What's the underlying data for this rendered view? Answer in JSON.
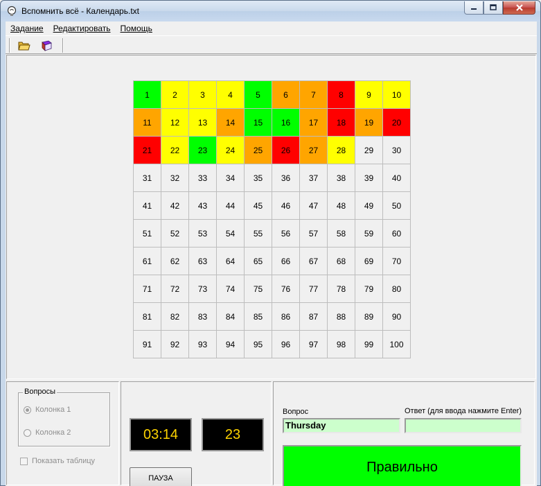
{
  "window": {
    "title": "Вспомнить всё - Календарь.txt"
  },
  "menu": [
    {
      "label": "Задание"
    },
    {
      "label": "Редактировать"
    },
    {
      "label": "Помощь"
    }
  ],
  "toolbar": {
    "buttons": [
      {
        "icon": "open-folder-icon"
      },
      {
        "icon": "book-icon"
      }
    ]
  },
  "grid": {
    "colors": {
      "green": "#00ff00",
      "yellow": "#ffff00",
      "orange": "#ffa500",
      "red": "#ff0000",
      "none": "#f0f0f0"
    },
    "cells": [
      {
        "n": "1",
        "c": "green"
      },
      {
        "n": "2",
        "c": "yellow"
      },
      {
        "n": "3",
        "c": "yellow"
      },
      {
        "n": "4",
        "c": "yellow"
      },
      {
        "n": "5",
        "c": "green"
      },
      {
        "n": "6",
        "c": "orange"
      },
      {
        "n": "7",
        "c": "orange"
      },
      {
        "n": "8",
        "c": "red"
      },
      {
        "n": "9",
        "c": "yellow"
      },
      {
        "n": "10",
        "c": "yellow"
      },
      {
        "n": "11",
        "c": "orange"
      },
      {
        "n": "12",
        "c": "yellow"
      },
      {
        "n": "13",
        "c": "yellow"
      },
      {
        "n": "14",
        "c": "orange"
      },
      {
        "n": "15",
        "c": "green"
      },
      {
        "n": "16",
        "c": "green"
      },
      {
        "n": "17",
        "c": "orange"
      },
      {
        "n": "18",
        "c": "red"
      },
      {
        "n": "19",
        "c": "orange"
      },
      {
        "n": "20",
        "c": "red"
      },
      {
        "n": "21",
        "c": "red"
      },
      {
        "n": "22",
        "c": "yellow"
      },
      {
        "n": "23",
        "c": "green"
      },
      {
        "n": "24",
        "c": "yellow"
      },
      {
        "n": "25",
        "c": "orange"
      },
      {
        "n": "26",
        "c": "red"
      },
      {
        "n": "27",
        "c": "orange"
      },
      {
        "n": "28",
        "c": "yellow"
      },
      {
        "n": "29",
        "c": "none"
      },
      {
        "n": "30",
        "c": "none"
      },
      {
        "n": "31",
        "c": "none"
      },
      {
        "n": "32",
        "c": "none"
      },
      {
        "n": "33",
        "c": "none"
      },
      {
        "n": "34",
        "c": "none"
      },
      {
        "n": "35",
        "c": "none"
      },
      {
        "n": "36",
        "c": "none"
      },
      {
        "n": "37",
        "c": "none"
      },
      {
        "n": "38",
        "c": "none"
      },
      {
        "n": "39",
        "c": "none"
      },
      {
        "n": "40",
        "c": "none"
      },
      {
        "n": "41",
        "c": "none"
      },
      {
        "n": "42",
        "c": "none"
      },
      {
        "n": "43",
        "c": "none"
      },
      {
        "n": "44",
        "c": "none"
      },
      {
        "n": "45",
        "c": "none"
      },
      {
        "n": "46",
        "c": "none"
      },
      {
        "n": "47",
        "c": "none"
      },
      {
        "n": "48",
        "c": "none"
      },
      {
        "n": "49",
        "c": "none"
      },
      {
        "n": "50",
        "c": "none"
      },
      {
        "n": "51",
        "c": "none"
      },
      {
        "n": "52",
        "c": "none"
      },
      {
        "n": "53",
        "c": "none"
      },
      {
        "n": "54",
        "c": "none"
      },
      {
        "n": "55",
        "c": "none"
      },
      {
        "n": "56",
        "c": "none"
      },
      {
        "n": "57",
        "c": "none"
      },
      {
        "n": "58",
        "c": "none"
      },
      {
        "n": "59",
        "c": "none"
      },
      {
        "n": "60",
        "c": "none"
      },
      {
        "n": "61",
        "c": "none"
      },
      {
        "n": "62",
        "c": "none"
      },
      {
        "n": "63",
        "c": "none"
      },
      {
        "n": "64",
        "c": "none"
      },
      {
        "n": "65",
        "c": "none"
      },
      {
        "n": "66",
        "c": "none"
      },
      {
        "n": "67",
        "c": "none"
      },
      {
        "n": "68",
        "c": "none"
      },
      {
        "n": "69",
        "c": "none"
      },
      {
        "n": "70",
        "c": "none"
      },
      {
        "n": "71",
        "c": "none"
      },
      {
        "n": "72",
        "c": "none"
      },
      {
        "n": "73",
        "c": "none"
      },
      {
        "n": "74",
        "c": "none"
      },
      {
        "n": "75",
        "c": "none"
      },
      {
        "n": "76",
        "c": "none"
      },
      {
        "n": "77",
        "c": "none"
      },
      {
        "n": "78",
        "c": "none"
      },
      {
        "n": "79",
        "c": "none"
      },
      {
        "n": "80",
        "c": "none"
      },
      {
        "n": "81",
        "c": "none"
      },
      {
        "n": "82",
        "c": "none"
      },
      {
        "n": "83",
        "c": "none"
      },
      {
        "n": "84",
        "c": "none"
      },
      {
        "n": "85",
        "c": "none"
      },
      {
        "n": "86",
        "c": "none"
      },
      {
        "n": "87",
        "c": "none"
      },
      {
        "n": "88",
        "c": "none"
      },
      {
        "n": "89",
        "c": "none"
      },
      {
        "n": "90",
        "c": "none"
      },
      {
        "n": "91",
        "c": "none"
      },
      {
        "n": "92",
        "c": "none"
      },
      {
        "n": "93",
        "c": "none"
      },
      {
        "n": "94",
        "c": "none"
      },
      {
        "n": "95",
        "c": "none"
      },
      {
        "n": "96",
        "c": "none"
      },
      {
        "n": "97",
        "c": "none"
      },
      {
        "n": "98",
        "c": "none"
      },
      {
        "n": "99",
        "c": "none"
      },
      {
        "n": "100",
        "c": "none"
      }
    ]
  },
  "questions_group": {
    "title": "Вопросы",
    "options": [
      {
        "label": "Колонка 1",
        "checked": true
      },
      {
        "label": "Колонка 2",
        "checked": false
      }
    ],
    "show_table_label": "Показать таблицу"
  },
  "timer": {
    "time": "03:14",
    "count": "23",
    "pause_label": "ПАУЗА"
  },
  "question": {
    "label": "Вопрос",
    "value": "Thursday"
  },
  "answer": {
    "label": "Ответ (для ввода нажмите Enter)",
    "value": ""
  },
  "result": {
    "text": "Правильно",
    "color": "#00ff00"
  }
}
